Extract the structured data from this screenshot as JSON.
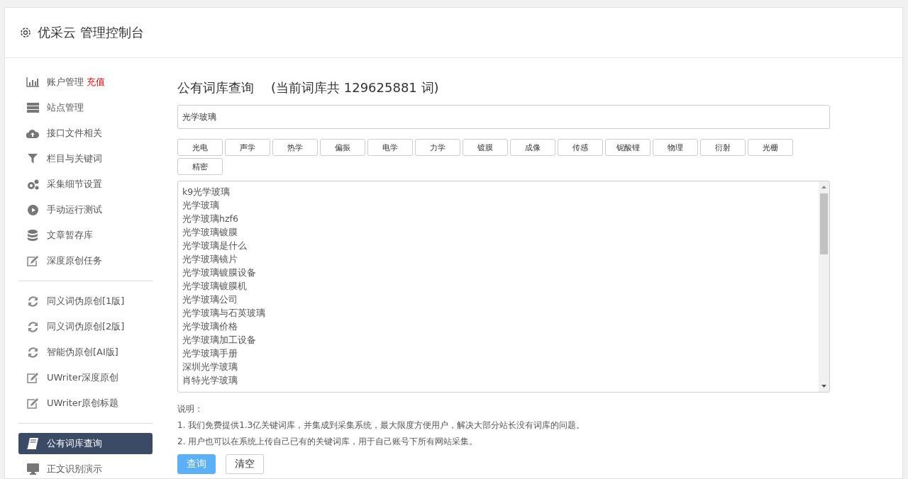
{
  "header": {
    "title": "优采云 管理控制台"
  },
  "sidebar": {
    "groups": [
      {
        "items": [
          {
            "kind": "chart",
            "label": "账户管理",
            "badge": "充值",
            "selected": false
          },
          {
            "kind": "server",
            "label": "站点管理",
            "selected": false
          },
          {
            "kind": "cloud",
            "label": "接口文件相关",
            "selected": false
          },
          {
            "kind": "filter",
            "label": "栏目与关键词",
            "selected": false
          },
          {
            "kind": "gears",
            "label": "采集细节设置",
            "selected": false
          },
          {
            "kind": "play",
            "label": "手动运行测试",
            "selected": false
          },
          {
            "kind": "database",
            "label": "文章暂存库",
            "selected": false
          },
          {
            "kind": "edit",
            "label": "深度原创任务",
            "selected": false
          }
        ]
      },
      {
        "items": [
          {
            "kind": "refresh",
            "label": "同义词伪原创[1版]",
            "selected": false
          },
          {
            "kind": "refresh",
            "label": "同义词伪原创[2版]",
            "selected": false
          },
          {
            "kind": "refresh",
            "label": "智能伪原创[AI版]",
            "selected": false
          },
          {
            "kind": "edit",
            "label": "UWriter深度原创",
            "selected": false
          },
          {
            "kind": "edit",
            "label": "UWriter原创标题",
            "selected": false
          }
        ]
      },
      {
        "items": [
          {
            "kind": "book",
            "label": "公有词库查询",
            "selected": true
          },
          {
            "kind": "monitor",
            "label": "正文识别演示",
            "selected": false
          }
        ]
      }
    ]
  },
  "main": {
    "title": "公有词库查询",
    "count_text": "(当前词库共 129625881 词)",
    "search": {
      "value": "光学玻璃"
    },
    "tags": [
      "光电",
      "声学",
      "热学",
      "偏振",
      "电学",
      "力学",
      "镀膜",
      "成像",
      "传感",
      "铌酸锂",
      "物理",
      "衍射",
      "光栅",
      "精密"
    ],
    "results": [
      "k9光学玻璃",
      "光学玻璃",
      "光学玻璃hzf6",
      "光学玻璃镀膜",
      "光学玻璃是什么",
      "光学玻璃镜片",
      "光学玻璃镀膜设备",
      "光学玻璃镀膜机",
      "光学玻璃公司",
      "光学玻璃与石英玻璃",
      "光学玻璃价格",
      "光学玻璃加工设备",
      "光学玻璃手册",
      "深圳光学玻璃",
      "肖特光学玻璃"
    ],
    "notes_title": "说明：",
    "notes": [
      "1. 我们免费提供1.3亿关键词库，并集成到采集系统，最大限度方便用户，解决大部分站长没有词库的问题。",
      "2. 用户也可以在系统上传自己已有的关键词库，用于自己账号下所有网站采集。"
    ],
    "buttons": [
      {
        "kind": "primary",
        "label": "查询"
      },
      {
        "kind": "default",
        "label": "清空"
      }
    ]
  }
}
